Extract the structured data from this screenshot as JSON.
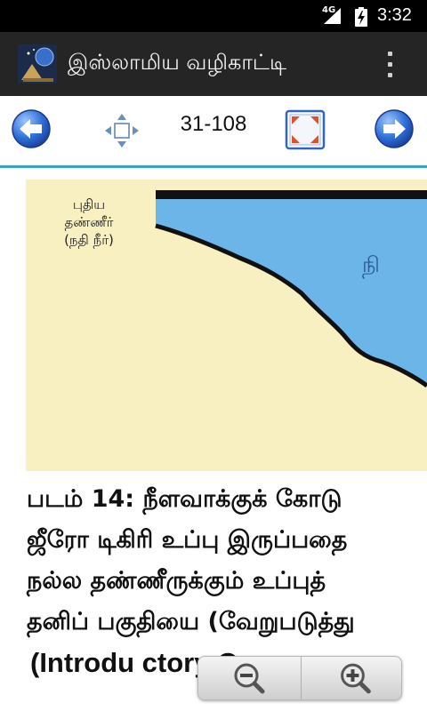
{
  "status_bar": {
    "network": "4G",
    "time": "3:32",
    "icons": [
      "signal-icon",
      "battery-charging-icon"
    ]
  },
  "action_bar": {
    "title": "இஸ்லாமிய வழிகாட்டி",
    "icons": [
      "app-icon",
      "overflow-menu-icon"
    ]
  },
  "toolbar": {
    "page_indicator": "31-108",
    "icons": [
      "arrow-left-icon",
      "move-icon",
      "fullscreen-icon",
      "arrow-right-icon"
    ],
    "accent_color": "#37a3cc"
  },
  "figure": {
    "label_lines": [
      "புதிய",
      "தண்ணீர்",
      "(நதி நீர்)"
    ],
    "water_color": "#6bb5e8",
    "land_color": "#f8f0c0"
  },
  "caption": {
    "lines": [
      "படம் 14: நீளவாக்குக் கோடு",
      "ஜீரோ டிகிரி உப்பு இருப்பதை",
      "நல்ல தண்ணீருக்கும் உப்புத்",
      "தனிப் பகுதியை (வேறுபடுத்து",
      "(Introdu ctory Oceano grap"
    ]
  },
  "zoom_controls": {
    "icons": [
      "zoom-out-icon",
      "zoom-in-icon"
    ]
  }
}
